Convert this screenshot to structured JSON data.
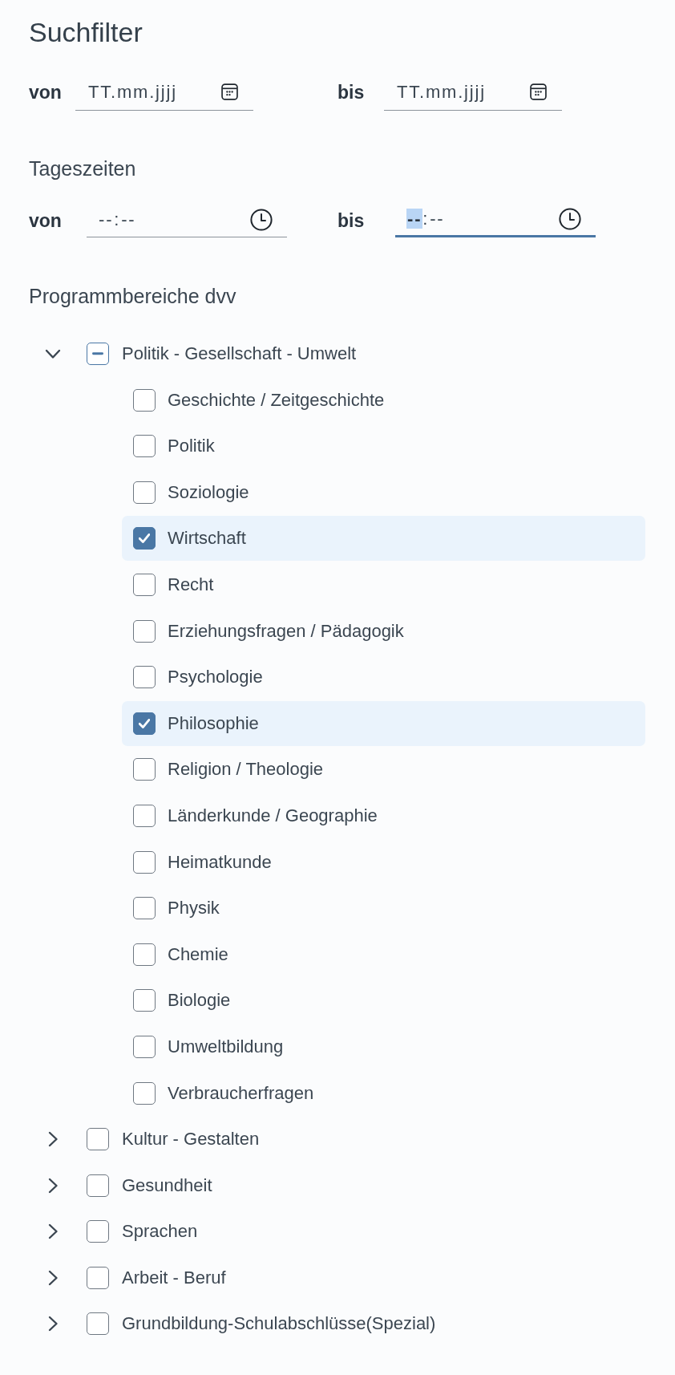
{
  "title": "Suchfilter",
  "date_range": {
    "from": {
      "label": "von",
      "placeholder": "TT.mm.jjjj"
    },
    "to": {
      "label": "bis",
      "placeholder": "TT.mm.jjjj"
    }
  },
  "time_section": {
    "heading": "Tageszeiten",
    "from": {
      "label": "von",
      "hour": "--",
      "separator": ":",
      "minute": "--",
      "focused": false,
      "hour_selected": false
    },
    "to": {
      "label": "bis",
      "hour": "--",
      "separator": ":",
      "minute": "--",
      "focused": true,
      "hour_selected": true
    }
  },
  "program_section": {
    "heading": "Programmbereiche dvv",
    "tree": [
      {
        "label": "Politik - Gesellschaft - Umwelt",
        "expanded": true,
        "checked": false,
        "indeterminate": true,
        "children": [
          {
            "label": "Geschichte / Zeitgeschichte",
            "checked": false
          },
          {
            "label": "Politik",
            "checked": false
          },
          {
            "label": "Soziologie",
            "checked": false
          },
          {
            "label": "Wirtschaft",
            "checked": true
          },
          {
            "label": "Recht",
            "checked": false
          },
          {
            "label": "Erziehungsfragen / Pädagogik",
            "checked": false
          },
          {
            "label": "Psychologie",
            "checked": false
          },
          {
            "label": "Philosophie",
            "checked": true
          },
          {
            "label": "Religion / Theologie",
            "checked": false
          },
          {
            "label": "Länderkunde / Geographie",
            "checked": false
          },
          {
            "label": "Heimatkunde",
            "checked": false
          },
          {
            "label": "Physik",
            "checked": false
          },
          {
            "label": "Chemie",
            "checked": false
          },
          {
            "label": "Biologie",
            "checked": false
          },
          {
            "label": "Umweltbildung",
            "checked": false
          },
          {
            "label": "Verbraucherfragen",
            "checked": false
          }
        ]
      },
      {
        "label": "Kultur - Gestalten",
        "expanded": false,
        "checked": false,
        "indeterminate": false
      },
      {
        "label": "Gesundheit",
        "expanded": false,
        "checked": false,
        "indeterminate": false
      },
      {
        "label": "Sprachen",
        "expanded": false,
        "checked": false,
        "indeterminate": false
      },
      {
        "label": "Arbeit - Beruf",
        "expanded": false,
        "checked": false,
        "indeterminate": false
      },
      {
        "label": "Grundbildung-Schulabschlüsse(Spezial)",
        "expanded": false,
        "checked": false,
        "indeterminate": false
      }
    ]
  }
}
